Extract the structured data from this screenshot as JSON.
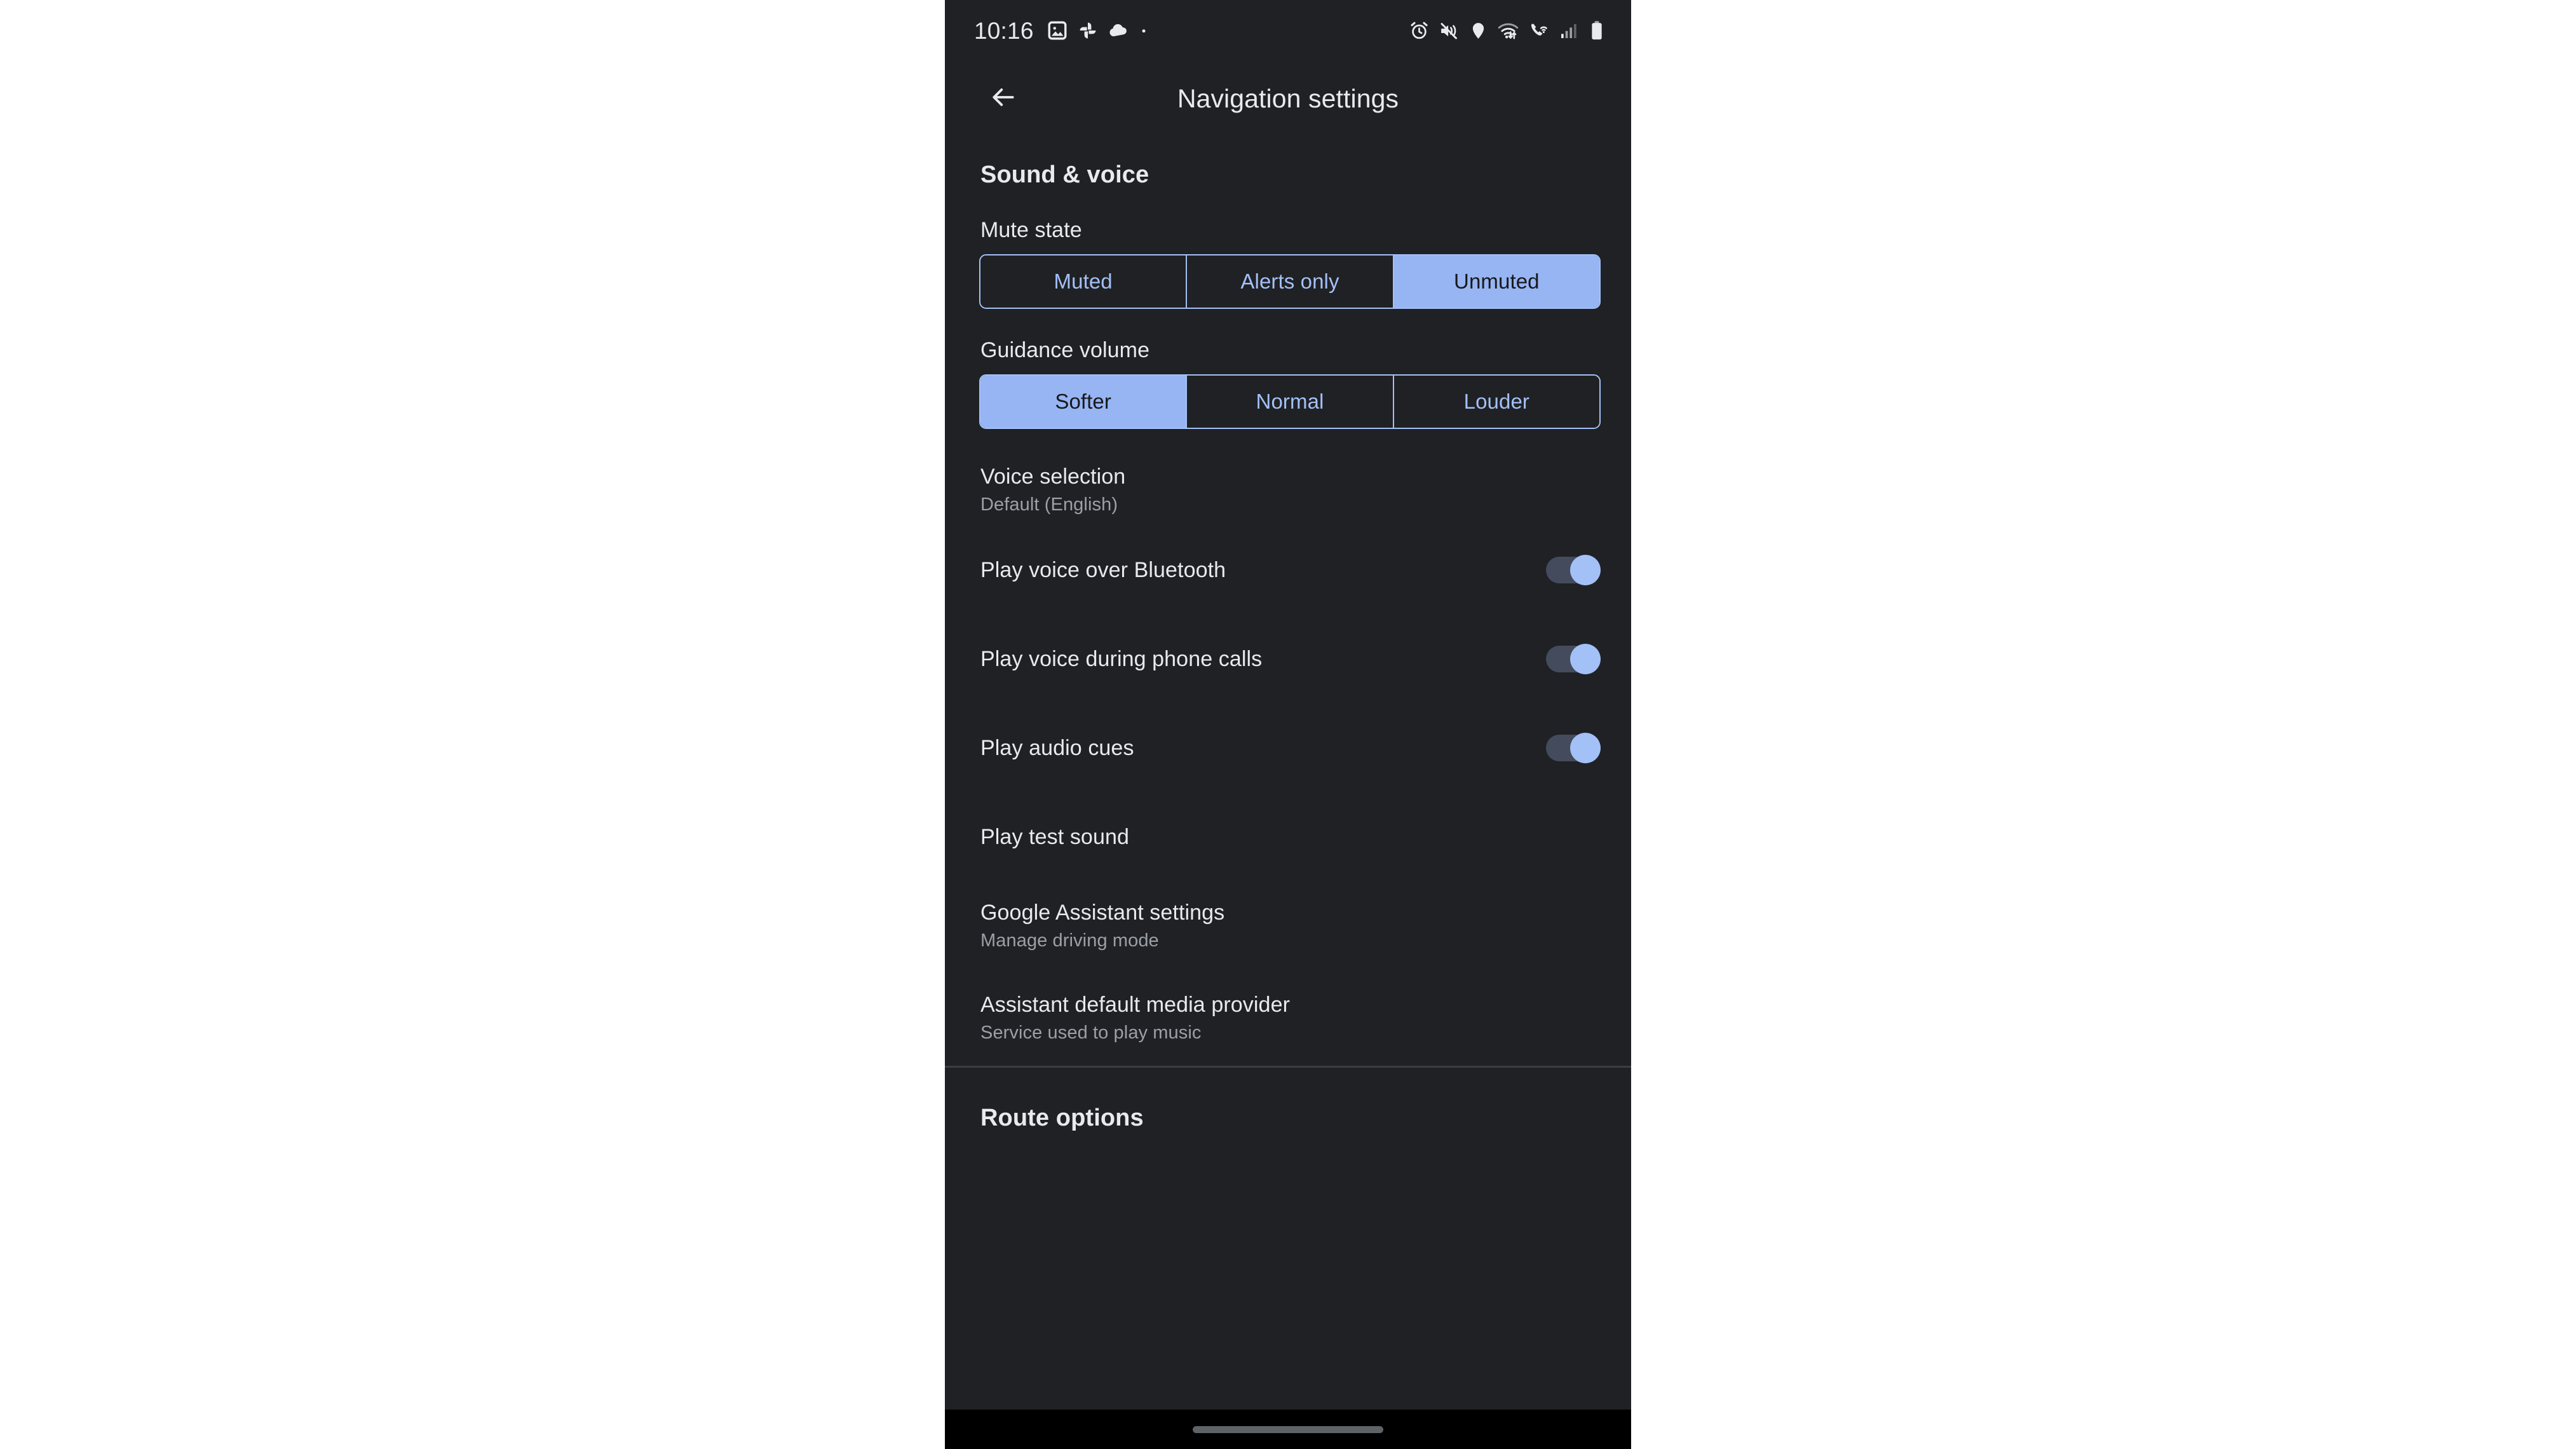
{
  "status_bar": {
    "time": "10:16",
    "left_icons": [
      "image-icon",
      "google-photos-pinwheel-icon",
      "cloud-icon",
      "dot-icon"
    ],
    "right_icons": [
      "alarm-icon",
      "vibrate-off-icon",
      "location-pin-icon",
      "wifi-data-icon",
      "wifi-calling-icon",
      "signal-bars-icon",
      "battery-icon"
    ]
  },
  "app_bar": {
    "back_label": "back-arrow",
    "title": "Navigation settings"
  },
  "sections": {
    "sound_voice": {
      "header": "Sound & voice",
      "mute_state": {
        "label": "Mute state",
        "options": [
          "Muted",
          "Alerts only",
          "Unmuted"
        ],
        "selected": "Unmuted"
      },
      "guidance_volume": {
        "label": "Guidance volume",
        "options": [
          "Softer",
          "Normal",
          "Louder"
        ],
        "selected": "Softer"
      },
      "voice_selection": {
        "title": "Voice selection",
        "subtitle": "Default (English)"
      },
      "play_voice_bluetooth": {
        "title": "Play voice over Bluetooth",
        "state": "on"
      },
      "play_voice_phone_calls": {
        "title": "Play voice during phone calls",
        "state": "on"
      },
      "play_audio_cues": {
        "title": "Play audio cues",
        "state": "on"
      },
      "play_test_sound": {
        "title": "Play test sound"
      },
      "google_assistant_settings": {
        "title": "Google Assistant settings",
        "subtitle": "Manage driving mode"
      },
      "assistant_default_media_provider": {
        "title": "Assistant default media provider",
        "subtitle": "Service used to play music"
      }
    },
    "route_options": {
      "header": "Route options"
    }
  },
  "colors": {
    "background": "#202124",
    "accent_blue": "#a3c0f7",
    "selected_fill": "#97b5f3",
    "primary_text": "#e8eaed",
    "secondary_text": "#9aa0a6",
    "toggle_track": "#444b5d",
    "divider": "#3a3d42"
  },
  "nav_bar": {
    "handle": "gesture-pill"
  }
}
